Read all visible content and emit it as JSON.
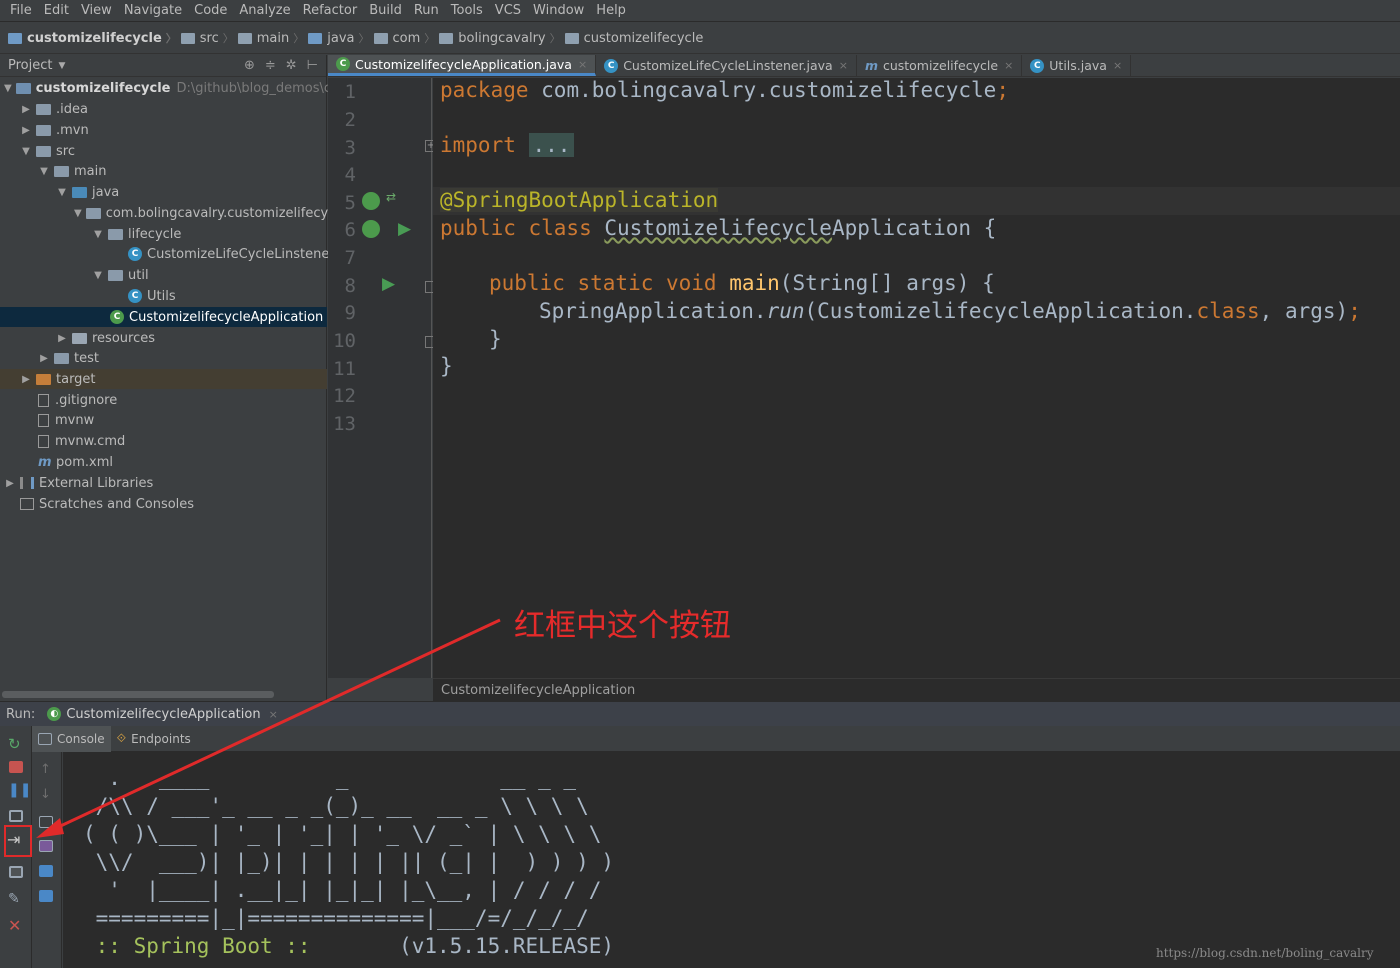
{
  "menu": [
    "File",
    "Edit",
    "View",
    "Navigate",
    "Code",
    "Analyze",
    "Refactor",
    "Build",
    "Run",
    "Tools",
    "VCS",
    "Window",
    "Help"
  ],
  "breadcrumbs": [
    "customizelifecycle",
    "src",
    "main",
    "java",
    "com",
    "bolingcavalry",
    "customizelifecycle"
  ],
  "project": {
    "title": "Project",
    "root_name": "customizelifecycle",
    "root_path": "D:\\github\\blog_demos\\custom",
    "items": [
      ".idea",
      ".mvn",
      "src",
      "main",
      "java",
      "com.bolingcavalry.customizelifecycle",
      "lifecycle",
      "CustomizeLifeCycleLinstener",
      "util",
      "Utils",
      "CustomizelifecycleApplication",
      "resources",
      "test",
      "target",
      ".gitignore",
      "mvnw",
      "mvnw.cmd",
      "pom.xml",
      "External Libraries",
      "Scratches and Consoles"
    ]
  },
  "tabs": [
    {
      "label": "CustomizelifecycleApplication.java",
      "active": true
    },
    {
      "label": "CustomizeLifeCycleLinstener.java",
      "active": false
    },
    {
      "label": "customizelifecycle",
      "active": false
    },
    {
      "label": "Utils.java",
      "active": false
    }
  ],
  "editor": {
    "line_numbers": [
      "1",
      "2",
      "3",
      "4",
      "5",
      "6",
      "7",
      "8",
      "9",
      "10",
      "11",
      "12",
      "13"
    ],
    "package_kw": "package",
    "package_name": " com.bolingcavalry.customizelifecycle",
    "import_kw": "import",
    "import_fold": "...",
    "annotation": "@SpringBootApplication",
    "class_decl_kw": "public class ",
    "class_name_a": "Customizelifecycle",
    "class_name_b": "Application",
    "brace_open": " {",
    "main_kw": "public static void ",
    "main_name": "main",
    "main_args": "(String[] args) {",
    "run_prefix": "SpringApplication.",
    "run_name": "run",
    "run_args": "(CustomizelifecycleApplication.",
    "class_kw": "class",
    "run_tail": ", args)",
    "semicolon": ";",
    "close_inner": "}",
    "close_outer": "}",
    "status_crumb": "CustomizelifecycleApplication"
  },
  "run": {
    "label": "Run:",
    "config_name": "CustomizelifecycleApplication",
    "subtabs": [
      "Console",
      "Endpoints"
    ],
    "ascii": [
      "  .   ____          _            __ _ _",
      " /\\\\ / ___'_ __ _ _(_)_ __  __ _ \\ \\ \\ \\",
      "( ( )\\___ | '_ | '_| | '_ \\/ _` | \\ \\ \\ \\",
      " \\\\/  ___)| |_)| | | | | || (_| |  ) ) ) )",
      "  '  |____| .__|_| |_|_| |_\\__, | / / / /",
      " =========|_|==============|___/=/_/_/_/"
    ],
    "spring_label": " :: Spring Boot ::",
    "version": "       (v1.5.15.RELEASE)"
  },
  "annotation_text": "红框中这个按钮",
  "watermark": "https://blog.csdn.net/boling_cavalry"
}
